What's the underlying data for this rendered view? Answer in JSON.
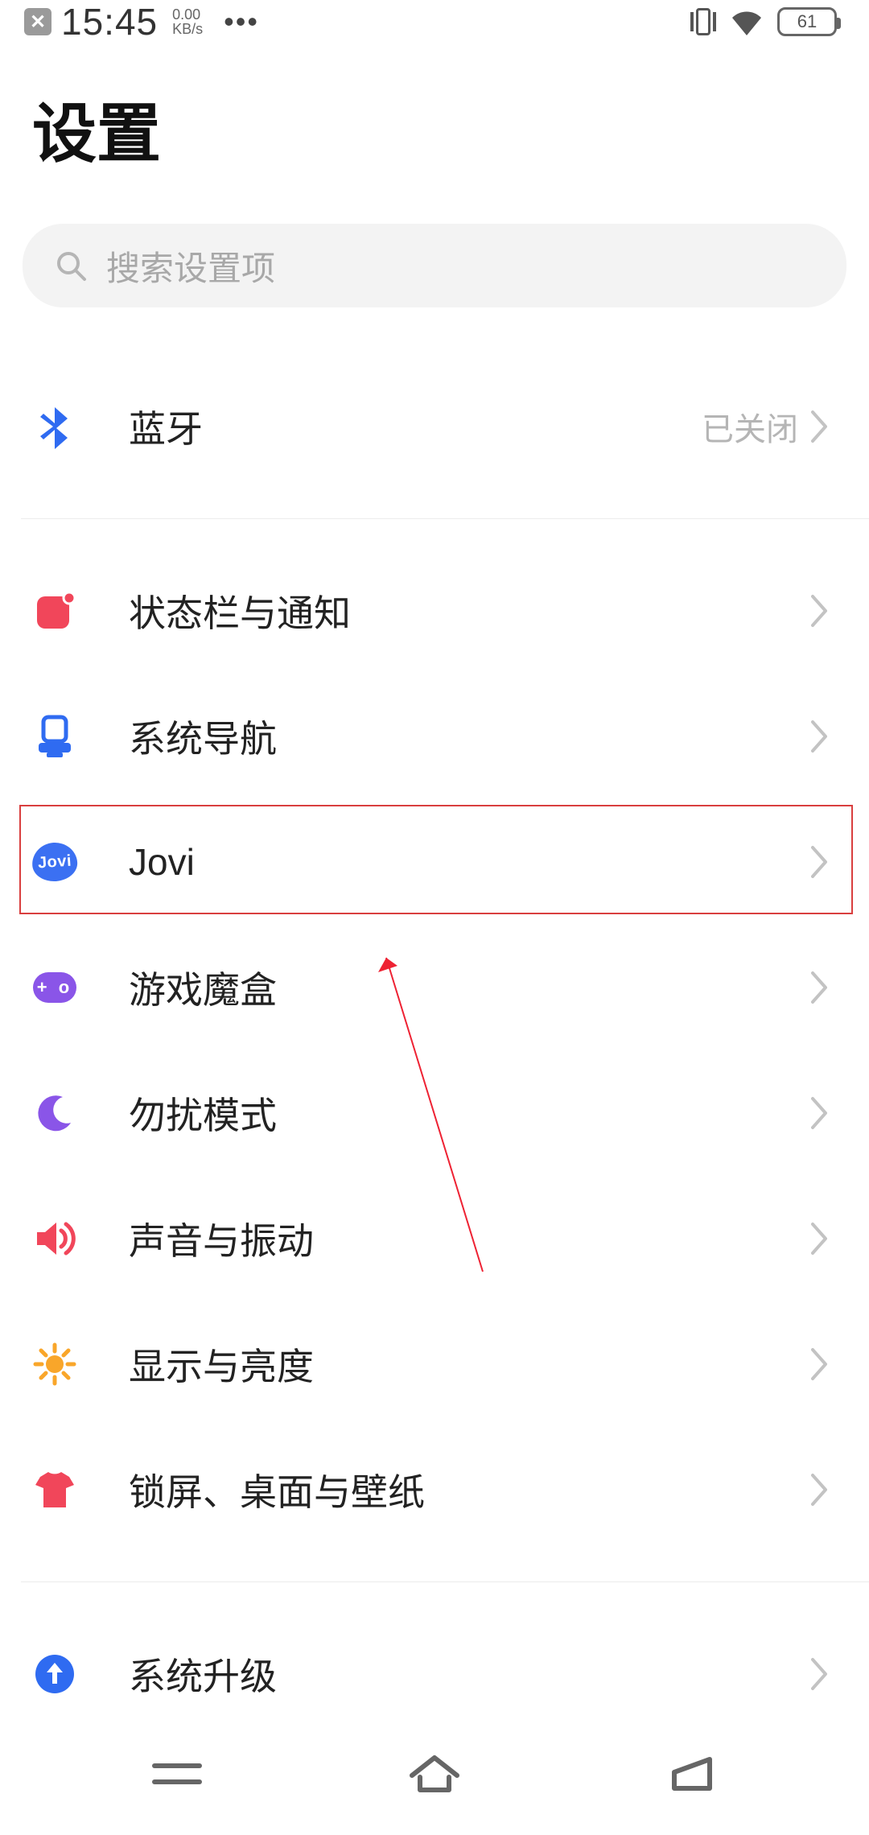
{
  "status_bar": {
    "time": "15:45",
    "net_speed_top": "0.00",
    "net_speed_bottom": "KB/s",
    "battery_text": "61"
  },
  "title": "设置",
  "search": {
    "placeholder": "搜索设置项"
  },
  "items": {
    "bluetooth": {
      "label": "蓝牙",
      "status": "已关闭"
    },
    "statusbar_notify": {
      "label": "状态栏与通知"
    },
    "system_nav": {
      "label": "系统导航"
    },
    "jovi": {
      "label": "Jovi",
      "icon_text": "Jovi"
    },
    "game_box": {
      "label": "游戏魔盒",
      "icon_text": "+ o"
    },
    "dnd": {
      "label": "勿扰模式"
    },
    "sound": {
      "label": "声音与振动"
    },
    "display": {
      "label": "显示与亮度"
    },
    "lockscreen": {
      "label": "锁屏、桌面与壁纸"
    },
    "system_update": {
      "label": "系统升级"
    }
  },
  "colors": {
    "blue": "#2f6bf1",
    "red": "#f1465a",
    "purple": "#8a55e8",
    "orange": "#f9a62a"
  }
}
